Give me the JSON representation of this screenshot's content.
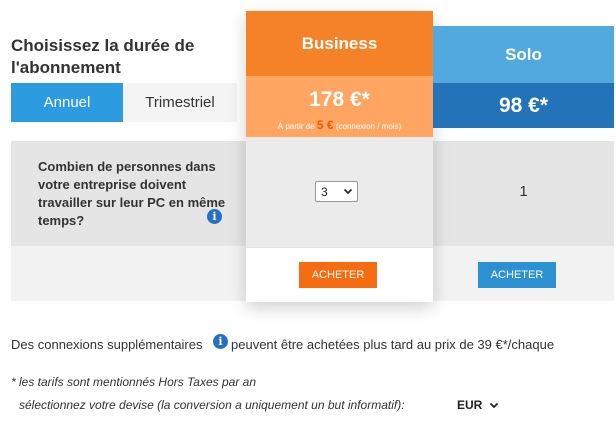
{
  "heading": {
    "title": "Choisissez la durée de l'abonnement"
  },
  "billing_toggle": {
    "annual_label": "Annuel",
    "quarterly_label": "Trimestriel",
    "selected": "Annuel"
  },
  "question": {
    "text": "Combien de personnes dans votre entreprise doivent travailler sur leur PC en même temps?",
    "info_icon": "i"
  },
  "plans": {
    "business": {
      "name": "Business",
      "price": "178 €*",
      "sub_prefix": "À partir de",
      "sub_amount": "5 €",
      "sub_suffix": "(connexion / mois)",
      "users_value": "3",
      "button": "ACHETER",
      "accent": "#f58226"
    },
    "solo": {
      "name": "Solo",
      "price": "98 €*",
      "users_value": "1",
      "button": "ACHETER",
      "accent": "#2273b7"
    }
  },
  "extra": {
    "before": "Des connexions supplémentaires",
    "after": "peuvent être achetées plus tard au prix de 39 €*/chaque",
    "info_icon": "i"
  },
  "notes": {
    "line1": "* les tarifs sont mentionnés Hors Taxes par an",
    "line2": "sélectionnez votre devise (la conversion a uniquement un but informatif):",
    "currency": "EUR"
  }
}
